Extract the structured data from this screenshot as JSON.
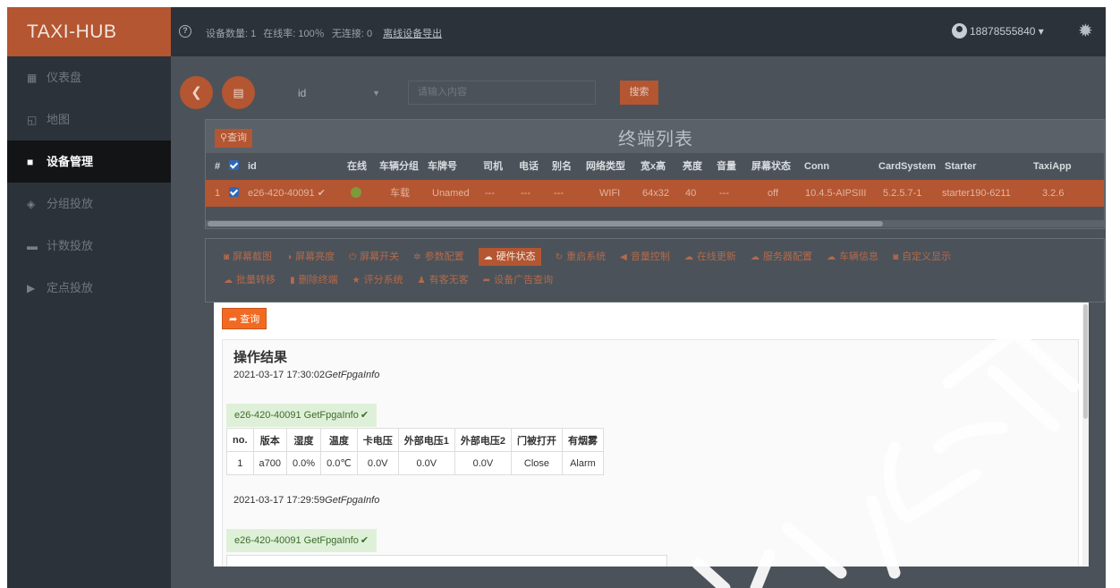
{
  "app": {
    "title": "TAXI-HUB"
  },
  "header": {
    "stats": [
      "设备数量: 1",
      "在线率: 100％",
      "无连接: 0"
    ],
    "export_link": "离线设备导出",
    "user": "18878555840",
    "user_caret": "▾"
  },
  "sidebar": {
    "items": [
      {
        "label": "仪表盘",
        "icon": "dashboard-icon",
        "glyph": "▦"
      },
      {
        "label": "地图",
        "icon": "map-icon",
        "glyph": "◱"
      },
      {
        "label": "设备管理",
        "icon": "car-icon",
        "glyph": "🚘",
        "active": true
      },
      {
        "label": "分组投放",
        "icon": "group-icon",
        "glyph": "◈"
      },
      {
        "label": "计数投放",
        "icon": "count-icon",
        "glyph": "▬"
      },
      {
        "label": "定点投放",
        "icon": "play-icon",
        "glyph": "▶"
      }
    ]
  },
  "search": {
    "field": "id",
    "placeholder": "请输入内容",
    "button": "搜索"
  },
  "terminal": {
    "query_button": "查询",
    "title": "终端列表",
    "columns": [
      "#",
      "id",
      "在线",
      "车辆分组",
      "车牌号",
      "司机",
      "电话",
      "别名",
      "网络类型",
      "宽x高",
      "亮度",
      "音量",
      "屏幕状态",
      "Conn",
      "CardSystem",
      "Starter",
      "TaxiApp"
    ],
    "row": [
      "1",
      "e26-420-40091",
      "",
      "车载",
      "Unamed",
      "---",
      "---",
      "---",
      "WIFI",
      "64x32",
      "40",
      "---",
      "off",
      "10.4.5-AIPSIII",
      "5.2.5.7-1",
      "starter190-6211",
      "3.2.6"
    ]
  },
  "actions": {
    "row1": [
      {
        "label": "屏幕截图",
        "icon": "camera-icon",
        "glyph": "◙"
      },
      {
        "label": "屏幕亮度",
        "icon": "brightness-icon",
        "glyph": "◑"
      },
      {
        "label": "屏幕开关",
        "icon": "power-icon",
        "glyph": "⏻"
      },
      {
        "label": "参数配置",
        "icon": "cog-icon",
        "glyph": "✲"
      },
      {
        "label": "硬件状态",
        "icon": "cloud-icon",
        "glyph": "☁",
        "active": true
      },
      {
        "label": "重启系统",
        "icon": "refresh-icon",
        "glyph": "↻"
      },
      {
        "label": "音量控制",
        "icon": "volume-icon",
        "glyph": "◀"
      },
      {
        "label": "在线更新",
        "icon": "cloud-update-icon",
        "glyph": "☁"
      },
      {
        "label": "服务器配置",
        "icon": "server-icon",
        "glyph": "☁"
      },
      {
        "label": "车辆信息",
        "icon": "vehicle-info-icon",
        "glyph": "☁"
      },
      {
        "label": "自定义显示",
        "icon": "custom-display-icon",
        "glyph": "◙"
      }
    ],
    "row2": [
      {
        "label": "批量转移",
        "icon": "transfer-icon",
        "glyph": "☁"
      },
      {
        "label": "删除终端",
        "icon": "trash-icon",
        "glyph": "▮"
      },
      {
        "label": "评分系统",
        "icon": "star-icon",
        "glyph": "★"
      },
      {
        "label": "有客无客",
        "icon": "passenger-icon",
        "glyph": "♟"
      },
      {
        "label": "设备广告查询",
        "icon": "share-icon",
        "glyph": "➦"
      }
    ]
  },
  "result": {
    "query_button": "查询",
    "title": "操作结果",
    "entries": [
      {
        "time": "2021-03-17 17:30:02",
        "cmd": "GetFpgaInfo",
        "device_label": "e26-420-40091 GetFpgaInfo",
        "headers": [
          "no.",
          "版本",
          "湿度",
          "温度",
          "卡电压",
          "外部电压1",
          "外部电压2",
          "门被打开",
          "有烟雾"
        ],
        "rows": [
          [
            "1",
            "a700",
            "0.0%",
            "0.0℃",
            "0.0V",
            "0.0V",
            "0.0V",
            "Close",
            "Alarm"
          ]
        ]
      },
      {
        "time": "2021-03-17 17:29:59",
        "cmd": "GetFpgaInfo",
        "device_label": "e26-420-40091 GetFpgaInfo"
      }
    ]
  },
  "colors": {
    "accent": "#b35631",
    "active_button": "#f26a22",
    "sidebar_bg": "#2c3239",
    "main_bg": "#4c5259",
    "success_bg": "#dff0d8"
  }
}
